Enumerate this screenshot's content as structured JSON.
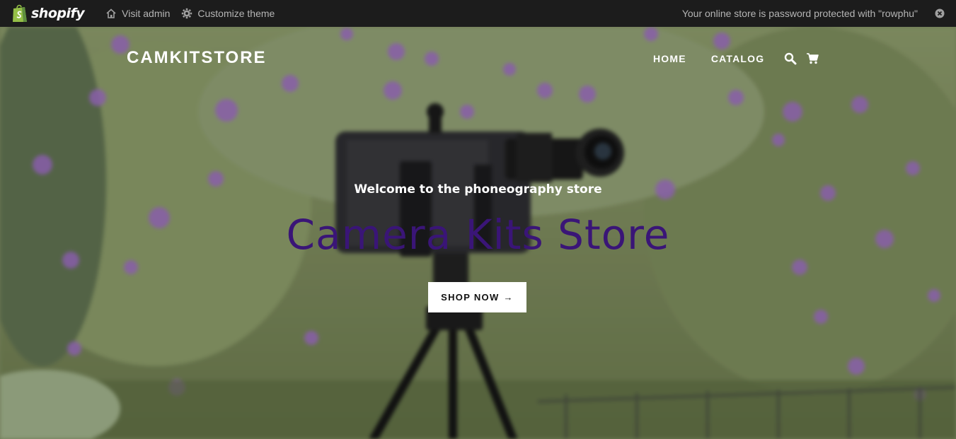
{
  "admin_bar": {
    "brand": "shopify",
    "visit_admin": "Visit admin",
    "customize_theme": "Customize theme",
    "password_notice": "Your online store is password protected with \"rowphu\""
  },
  "header": {
    "logo": "CAMKITSTORE",
    "nav": [
      "HOME",
      "CATALOG"
    ]
  },
  "hero": {
    "subtitle": "Welcome to the phoneography store",
    "title": "Camera Kits Store",
    "title_color": "#3a1577",
    "cta_label": "SHOP NOW",
    "cta_arrow": "→"
  },
  "icons": {
    "brand": "shopify-bag-icon",
    "visit_admin": "home-icon",
    "customize": "gear-icon",
    "close": "close-icon",
    "search": "search-icon",
    "cart": "cart-icon"
  },
  "colors": {
    "admin_bar": "#1c1c1c",
    "shopify_green": "#95bf47"
  }
}
